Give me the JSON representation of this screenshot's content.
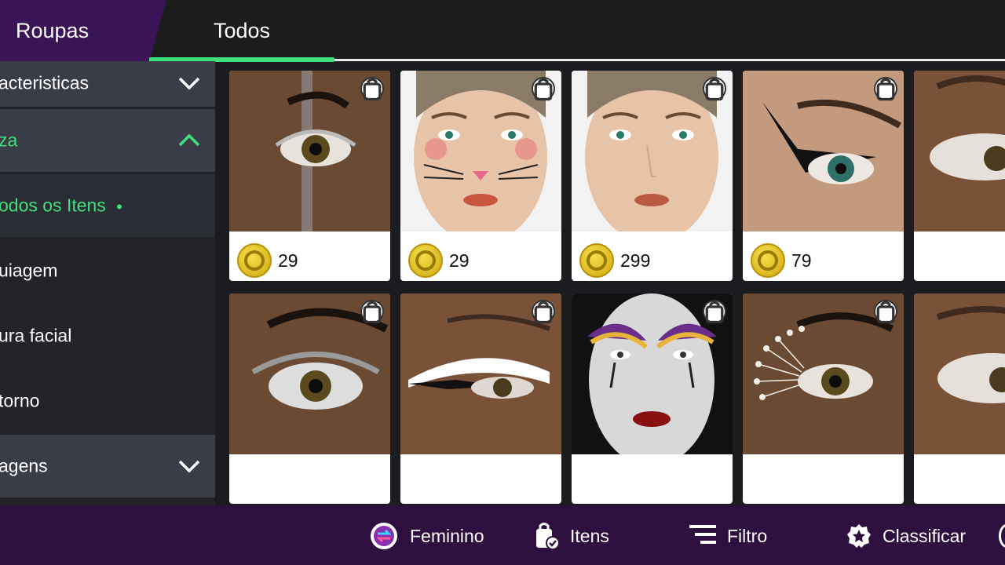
{
  "header": {
    "tab_roupas": "Roupas",
    "tab_todos": "Todos"
  },
  "sidebar": {
    "items": [
      {
        "label": "acteristicas",
        "type": "category",
        "expanded": false
      },
      {
        "label": "za",
        "type": "category",
        "expanded": true
      },
      {
        "label": "odos os Itens",
        "type": "sub",
        "active": true
      },
      {
        "label": "uiagem",
        "type": "sub"
      },
      {
        "label": "ura facial",
        "type": "sub"
      },
      {
        "label": "torno",
        "type": "sub"
      },
      {
        "label": "agens",
        "type": "category",
        "expanded": false
      }
    ]
  },
  "grid": {
    "items": [
      {
        "price": "29",
        "thumb": "eye-silver-tear"
      },
      {
        "price": "29",
        "thumb": "face-cat-whiskers"
      },
      {
        "price": "299",
        "thumb": "face-plain"
      },
      {
        "price": "79",
        "thumb": "eye-black-wing"
      },
      {
        "price": "",
        "thumb": "eye-white-partial"
      },
      {
        "price": "",
        "thumb": "eye-silver-lashes"
      },
      {
        "price": "",
        "thumb": "eye-white-liner"
      },
      {
        "price": "",
        "thumb": "face-gothic"
      },
      {
        "price": "",
        "thumb": "eye-dot-pearls"
      },
      {
        "price": "",
        "thumb": "eye-white-partial-2"
      }
    ]
  },
  "bottombar": {
    "feminino": "Feminino",
    "itens": "Itens",
    "filtro": "Filtro",
    "classificar": "Classificar"
  },
  "colors": {
    "accent": "#3ee07c",
    "purple": "#3a1456",
    "bottom": "#2e1040",
    "coin": "#e6c21f"
  }
}
